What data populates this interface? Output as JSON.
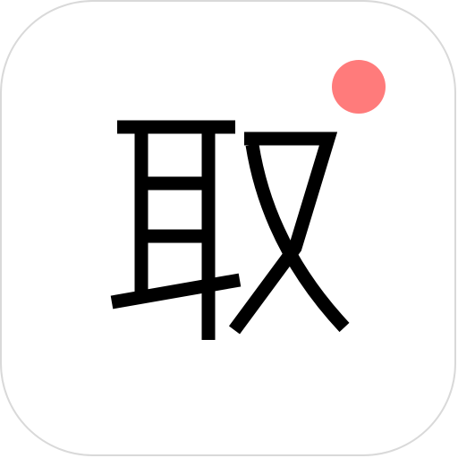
{
  "app_icon": {
    "character": "取",
    "badge_color": "#FF7B7B"
  }
}
